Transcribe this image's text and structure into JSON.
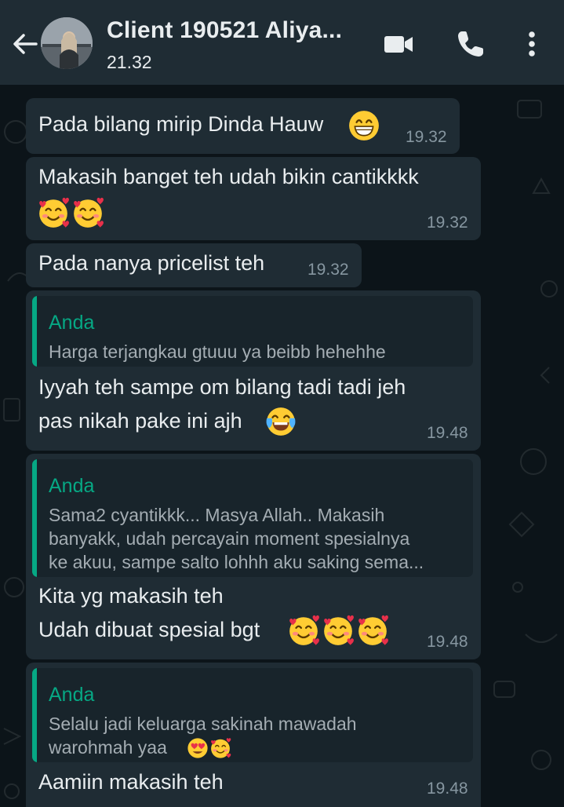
{
  "header": {
    "title": "Client 190521 Aliya...",
    "subtitle": "21.32",
    "icons": [
      "back-arrow-icon",
      "video-call-icon",
      "phone-icon",
      "more-options-icon"
    ]
  },
  "messages": [
    {
      "text": "Pada bilang mirip Dinda Hauw",
      "emoji": "grinning-face",
      "time": "19.32"
    },
    {
      "text_line1": "Makasih banget teh udah bikin cantikkkk",
      "emoji": "smiling-face-with-hearts x2",
      "time": "19.32"
    },
    {
      "text": "Pada nanya pricelist teh",
      "time": "19.32"
    },
    {
      "quote_author": "Anda",
      "quote_text": "Harga terjangkau gtuuu ya beibb hehehhe",
      "text_line1": "Iyyah teh sampe om bilang tadi tadi jeh",
      "text_line2": "pas nikah pake ini ajh",
      "emoji": "face-with-tears-of-joy",
      "time": "19.48"
    },
    {
      "quote_author": "Anda",
      "quote_line1": "Sama2 cyantikkk... Masya Allah.. Makasih",
      "quote_line2": "banyakk, udah percayain moment spesialnya",
      "quote_line3": "ke akuu, sampe salto lohhh aku saking sema...",
      "text_line1": "Kita yg makasih teh",
      "text_line2": "Udah dibuat spesial bgt",
      "emoji": "smiling-face-with-hearts x3",
      "time": "19.48"
    },
    {
      "quote_author": "Anda",
      "quote_line1": "Selalu jadi keluarga sakinah mawadah",
      "quote_line2": "warohmah yaa",
      "quote_emoji": "heart-eyes, smiling-face-with-hearts",
      "text": "Aamiin makasih teh",
      "time": "19.48"
    }
  ],
  "colors": {
    "header_bg": "#1f2c34",
    "chat_bg": "#0c1419",
    "bubble_bg": "#1f2c34",
    "quote_accent": "#06a884",
    "text": "#e9edef",
    "timestamp": "#8696a0"
  }
}
